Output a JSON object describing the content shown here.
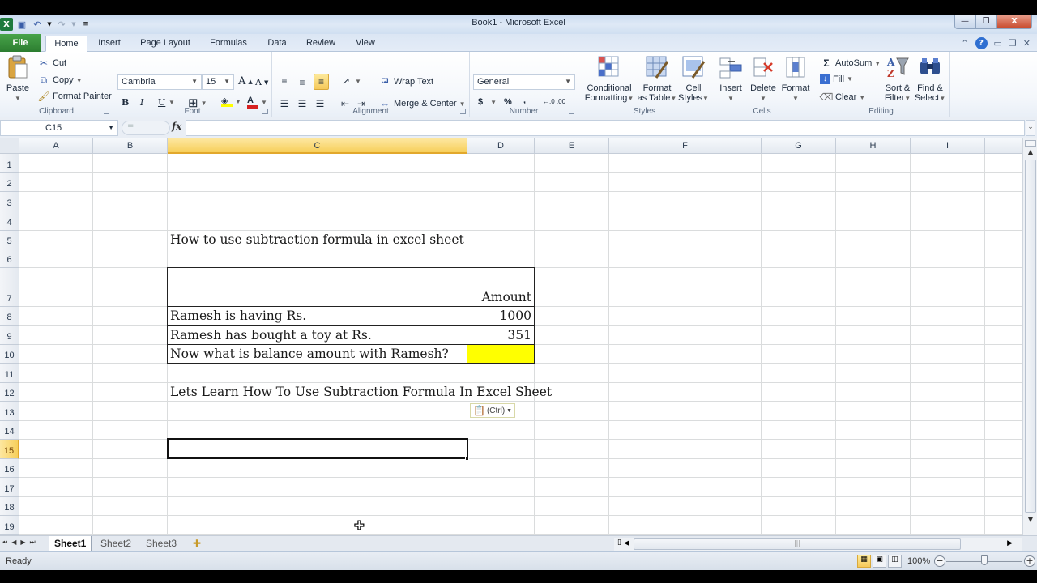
{
  "window": {
    "title": "Book1  -  Microsoft Excel",
    "controls": {
      "minimize": "—",
      "restore": "❐",
      "close": "X"
    }
  },
  "quick_access": {
    "icons": [
      "excel-logo",
      "save-icon",
      "undo-icon",
      "redo-icon",
      "customize-icon"
    ]
  },
  "tabs": [
    {
      "label": "File"
    },
    {
      "label": "Home"
    },
    {
      "label": "Insert"
    },
    {
      "label": "Page Layout"
    },
    {
      "label": "Formulas"
    },
    {
      "label": "Data"
    },
    {
      "label": "Review"
    },
    {
      "label": "View"
    }
  ],
  "ribbon": {
    "clipboard": {
      "label": "Clipboard",
      "paste": "Paste",
      "cut": "Cut",
      "copy": "Copy",
      "format_painter": "Format Painter"
    },
    "font": {
      "label": "Font",
      "font_name": "Cambria",
      "font_size": "15",
      "bold": "B",
      "italic": "I",
      "underline": "U"
    },
    "alignment": {
      "label": "Alignment",
      "wrap_text": "Wrap Text",
      "merge_center": "Merge & Center"
    },
    "number": {
      "label": "Number",
      "format": "General",
      "currency": "$",
      "percent": "%",
      "comma": ",",
      "inc_decimal": "←.0 .00",
      "dec_decimal": ".00 →.0"
    },
    "styles": {
      "label": "Styles",
      "conditional_1": "Conditional",
      "conditional_2": "Formatting",
      "format_table_1": "Format",
      "format_table_2": "as Table",
      "cell_styles_1": "Cell",
      "cell_styles_2": "Styles"
    },
    "cells": {
      "label": "Cells",
      "insert": "Insert",
      "delete": "Delete",
      "format": "Format"
    },
    "editing": {
      "label": "Editing",
      "autosum": "AutoSum",
      "fill": "Fill",
      "clear": "Clear",
      "sort_1": "Sort &",
      "sort_2": "Filter",
      "find_1": "Find &",
      "find_2": "Select"
    },
    "accent_color": "#f6c95a"
  },
  "formula_bar": {
    "name_box": "C15",
    "fx": "fx",
    "formula": ""
  },
  "columns": [
    "A",
    "B",
    "C",
    "D",
    "E",
    "F",
    "G",
    "H",
    "I"
  ],
  "selected_column": "C",
  "rows": [
    "1",
    "2",
    "3",
    "4",
    "5",
    "6",
    "7",
    "8",
    "9",
    "10",
    "11",
    "12",
    "13",
    "14",
    "15",
    "16",
    "17",
    "18",
    "19"
  ],
  "selected_row": "15",
  "cells": {
    "C5": "How to use subtraction formula in excel sheet",
    "D7": "Amount",
    "C8": "Ramesh is having Rs.",
    "D8": "1000",
    "C9": "Ramesh has bought a toy at Rs.",
    "D9": "351",
    "C10": "Now what is balance amount with Ramesh?",
    "D10": "",
    "C12": "Lets Learn How To Use Subtraction Formula In Excel Sheet"
  },
  "highlight_color": "#ffff00",
  "paste_options": {
    "label": "(Ctrl)"
  },
  "sheets": [
    {
      "label": "Sheet1",
      "active": true
    },
    {
      "label": "Sheet2",
      "active": false
    },
    {
      "label": "Sheet3",
      "active": false
    }
  ],
  "status": {
    "text": "Ready",
    "zoom": "100%",
    "zoom_level_percent": 100
  }
}
